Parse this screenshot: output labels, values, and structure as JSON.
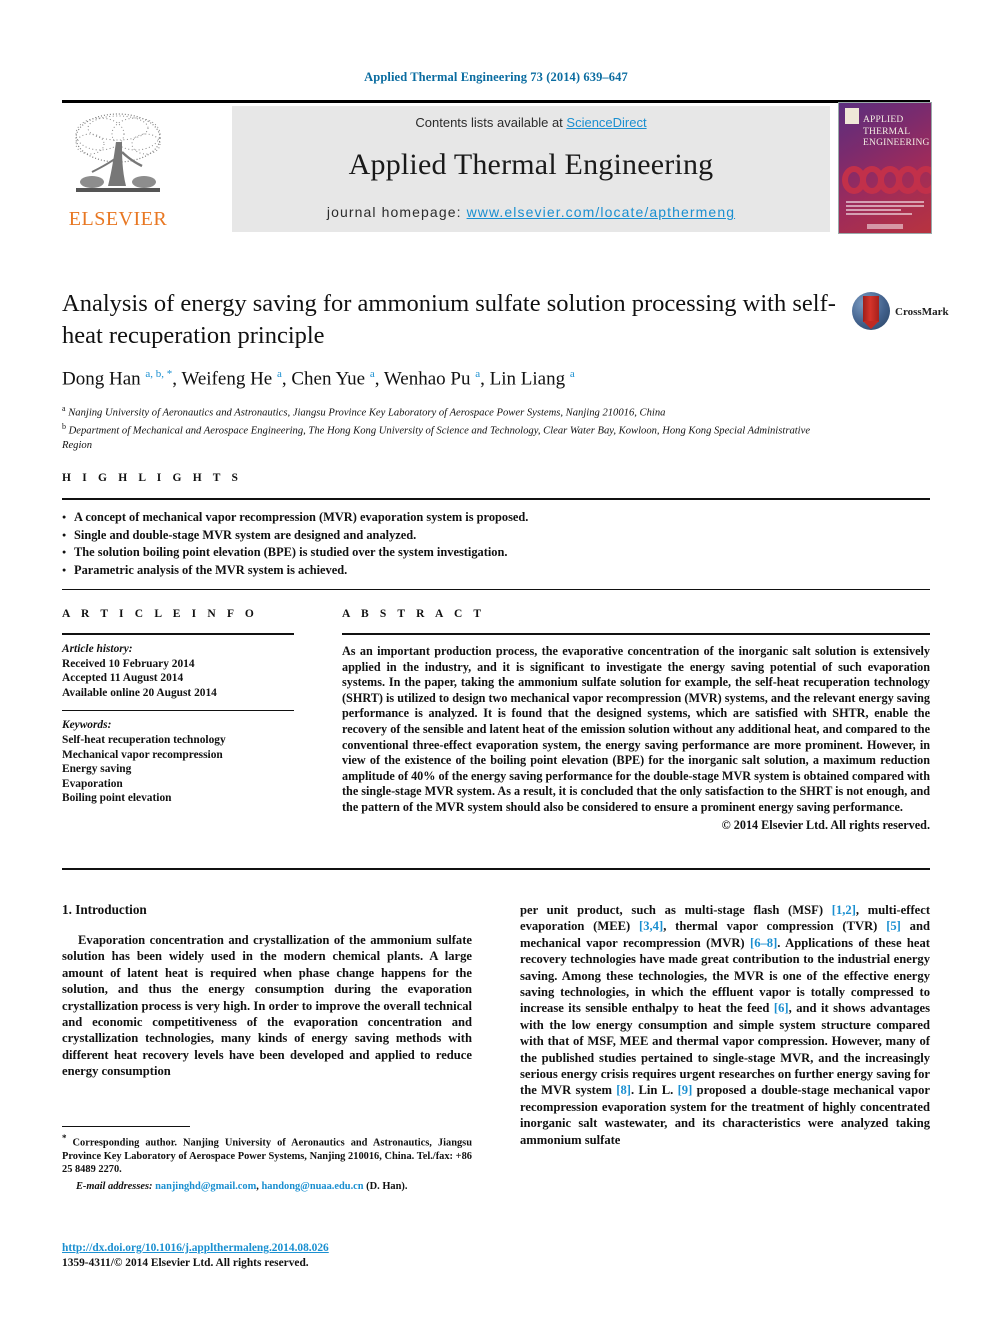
{
  "running_head": "Applied Thermal Engineering 73 (2014) 639–647",
  "masthead": {
    "contents_prefix": "Contents lists available at ",
    "sciencedirect": "ScienceDirect",
    "journal_title": "Applied Thermal Engineering",
    "homepage_prefix": "journal homepage: ",
    "homepage_url": "www.elsevier.com/locate/apthermeng",
    "publisher": "ELSEVIER",
    "cover_title": "APPLIED THERMAL ENGINEERING",
    "link_color": "#1a8fd0",
    "publisher_color": "#E87722",
    "band_color": "#e7e7e7"
  },
  "article": {
    "title": "Analysis of energy saving for ammonium sulfate solution processing with self-heat recuperation principle",
    "authors_html": "Dong Han <sup>a, b, *</sup>, Weifeng He <sup>a</sup>, Chen Yue <sup>a</sup>, Wenhao Pu <sup>a</sup>, Lin Liang <sup>a</sup>",
    "affiliation_a": "Nanjing University of Aeronautics and Astronautics, Jiangsu Province Key Laboratory of Aerospace Power Systems, Nanjing 210016, China",
    "affiliation_b": "Department of Mechanical and Aerospace Engineering, The Hong Kong University of Science and Technology, Clear Water Bay, Kowloon, Hong Kong Special Administrative Region",
    "crossmark_label": "CrossMark"
  },
  "highlights": {
    "label": "H I G H L I G H T S",
    "items": [
      "A concept of mechanical vapor recompression (MVR) evaporation system is proposed.",
      "Single and double-stage MVR system are designed and analyzed.",
      "The solution boiling point elevation (BPE) is studied over the system investigation.",
      "Parametric analysis of the MVR system is achieved."
    ]
  },
  "article_info": {
    "label": "A R T I C L E  I N F O",
    "history_heading": "Article history:",
    "history": [
      "Received 10 February 2014",
      "Accepted 11 August 2014",
      "Available online 20 August 2014"
    ],
    "keywords_heading": "Keywords:",
    "keywords": [
      "Self-heat recuperation technology",
      "Mechanical vapor recompression",
      "Energy saving",
      "Evaporation",
      "Boiling point elevation"
    ]
  },
  "abstract": {
    "label": "A B S T R A C T",
    "text": "As an important production process, the evaporative concentration of the inorganic salt solution is extensively applied in the industry, and it is significant to investigate the energy saving potential of such evaporation systems. In the paper, taking the ammonium sulfate solution for example, the self-heat recuperation technology (SHRT) is utilized to design two mechanical vapor recompression (MVR) systems, and the relevant energy saving performance is analyzed. It is found that the designed systems, which are satisfied with SHTR, enable the recovery of the sensible and latent heat of the emission solution without any additional heat, and compared to the conventional three-effect evaporation system, the energy saving performance are more prominent. However, in view of the existence of the boiling point elevation (BPE) for the inorganic salt solution, a maximum reduction amplitude of 40% of the energy saving performance for the double-stage MVR system is obtained compared with the single-stage MVR system. As a result, it is concluded that the only satisfaction to the SHRT is not enough, and the pattern of the MVR system should also be considered to ensure a prominent energy saving performance.",
    "copyright": "© 2014 Elsevier Ltd. All rights reserved."
  },
  "body": {
    "section_heading": "1.  Introduction",
    "left_paragraph": "Evaporation concentration and crystallization of the ammonium sulfate solution has been widely used in the modern chemical plants. A large amount of latent heat is required when phase change happens for the solution, and thus the energy consumption during the evaporation crystallization process is very high. In order to improve the overall technical and economic competitiveness of the evaporation concentration and crystallization technologies, many kinds of energy saving methods with different heat recovery levels have been developed and applied to reduce energy consumption",
    "right_paragraph_html": "per unit product, such as multi-stage flash (MSF) <span class=\"ref\">[1,2]</span>, multi-effect evaporation (MEE) <span class=\"ref\">[3,4]</span>, thermal vapor compression (TVR) <span class=\"ref\">[5]</span> and mechanical vapor recompression (MVR) <span class=\"ref\">[6&ndash;8]</span>. Applications of these heat recovery technologies have made great contribution to the industrial energy saving. Among these technologies, the MVR is one of the effective energy saving technologies, in which the effluent vapor is totally compressed to increase its sensible enthalpy to heat the feed <span class=\"ref\">[6]</span>, and it shows advantages with the low energy consumption and simple system structure compared with that of MSF, MEE and thermal vapor compression. However, many of the published studies pertained to single-stage MVR, and the increasingly serious energy crisis requires urgent researches on further energy saving for the MVR system <span class=\"ref\">[8]</span>. Lin L. <span class=\"ref\">[9]</span> proposed a double-stage mechanical vapor recompression evaporation system for the treatment of highly concentrated inorganic salt wastewater, and its characteristics were analyzed taking ammonium sulfate"
  },
  "footnotes": {
    "corresponding_html": "<span class=\"star\">*</span> Corresponding author. Nanjing University of Aeronautics and Astronautics, Jiangsu Province Key Laboratory of Aerospace Power Systems, Nanjing 210016, China. Tel./fax: +86 25 8489 2270.",
    "email_label": "E-mail addresses:",
    "email_1": "nanjinghd@gmail.com",
    "email_2": "handong@nuaa.edu.cn",
    "email_suffix": "(D. Han)."
  },
  "imprint": {
    "doi": "http://dx.doi.org/10.1016/j.applthermaleng.2014.08.026",
    "issn_line": "1359-4311/© 2014 Elsevier Ltd. All rights reserved."
  }
}
